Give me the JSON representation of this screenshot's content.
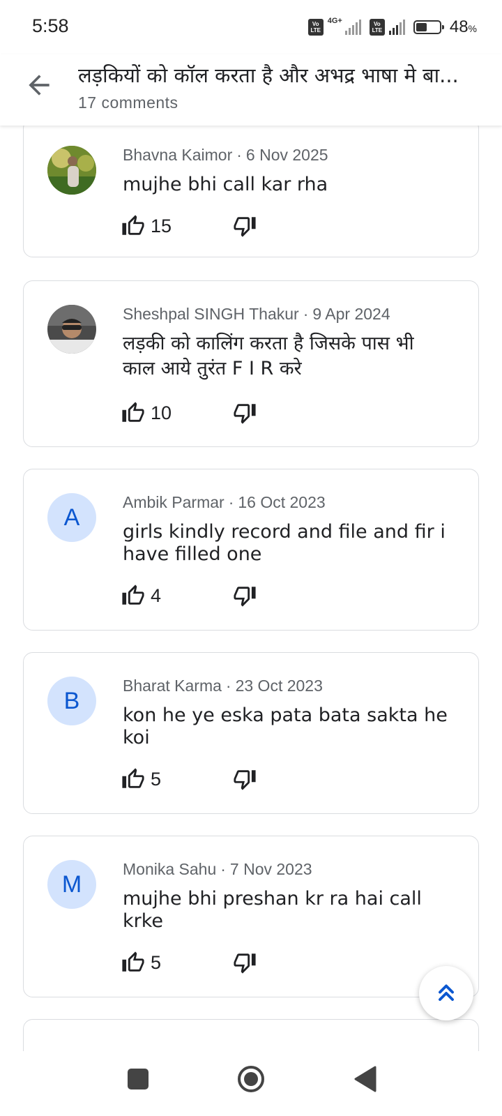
{
  "status_bar": {
    "time": "5:58",
    "network": "4G+",
    "volte_label_top": "Vo",
    "volte_label_bottom": "LTE",
    "battery_text": "48",
    "battery_unit": "%",
    "battery_level": 0.48
  },
  "header": {
    "title": "लड़कियों को कॉल करता है और अभद्र भाषा मे बा...",
    "subtitle": "17 comments"
  },
  "comments": [
    {
      "author": "Bhavna Kaimor",
      "date": "6 Nov 2025",
      "text": "mujhe bhi call kar rha",
      "likes": "15",
      "avatar_type": "photo"
    },
    {
      "author": "Sheshpal SINGH Thakur",
      "date": "9 Apr 2024",
      "text": "लड़की को कालिंग करता है जिसके पास भी काल आये तुरंत F I R करे",
      "likes": "10",
      "avatar_type": "photo"
    },
    {
      "author": "Ambik Parmar",
      "date": "16 Oct 2023",
      "text": "girls kindly record and file and fir i have filled one",
      "likes": "4",
      "avatar_letter": "A"
    },
    {
      "author": "Bharat Karma",
      "date": "23 Oct 2023",
      "text": "kon he ye eska pata bata sakta he koi",
      "likes": "5",
      "avatar_letter": "B"
    },
    {
      "author": "Monika Sahu",
      "date": "7 Nov 2023",
      "text": "mujhe bhi preshan kr ra hai call krke",
      "likes": "5",
      "avatar_letter": "M"
    }
  ],
  "separator": "·",
  "icons": {
    "back": "arrow-back-icon",
    "like": "thumb-up-icon",
    "dislike": "thumb-down-icon",
    "scroll_top": "double-chevron-up-icon",
    "nav_recents": "square-icon",
    "nav_home": "circle-icon",
    "nav_back": "triangle-back-icon"
  },
  "colors": {
    "accent": "#0b57d0",
    "avatar_bg": "#d3e3fd",
    "card_border": "#dadce0",
    "secondary_text": "#5f6368"
  }
}
